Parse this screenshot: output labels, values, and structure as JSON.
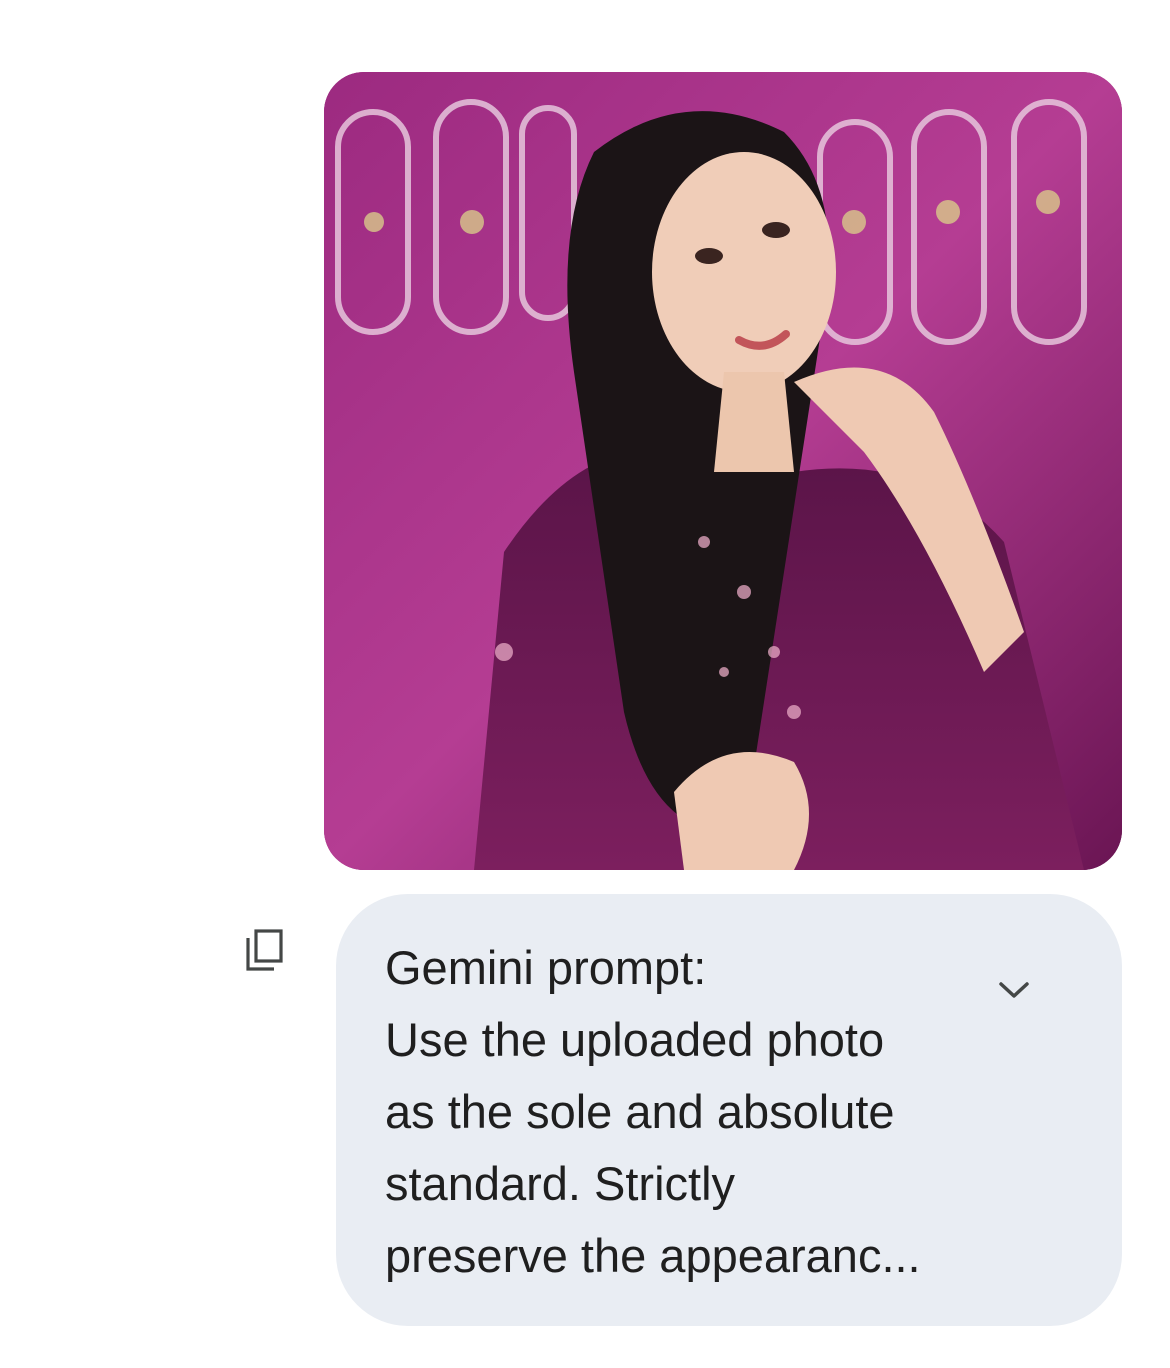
{
  "message": {
    "image": {
      "alt": "",
      "icon": "photo"
    },
    "copy_icon": "copy-icon",
    "expand_icon": "chevron-down-icon",
    "prompt_title": "Gemini prompt:",
    "prompt_lines": [
      "Use the uploaded photo",
      "as the sole and absolute",
      "standard. Strictly",
      "preserve the appearanc..."
    ]
  },
  "colors": {
    "bubble_bg": "#e9edf3",
    "text": "#1f1f1f",
    "icon": "#444746"
  }
}
